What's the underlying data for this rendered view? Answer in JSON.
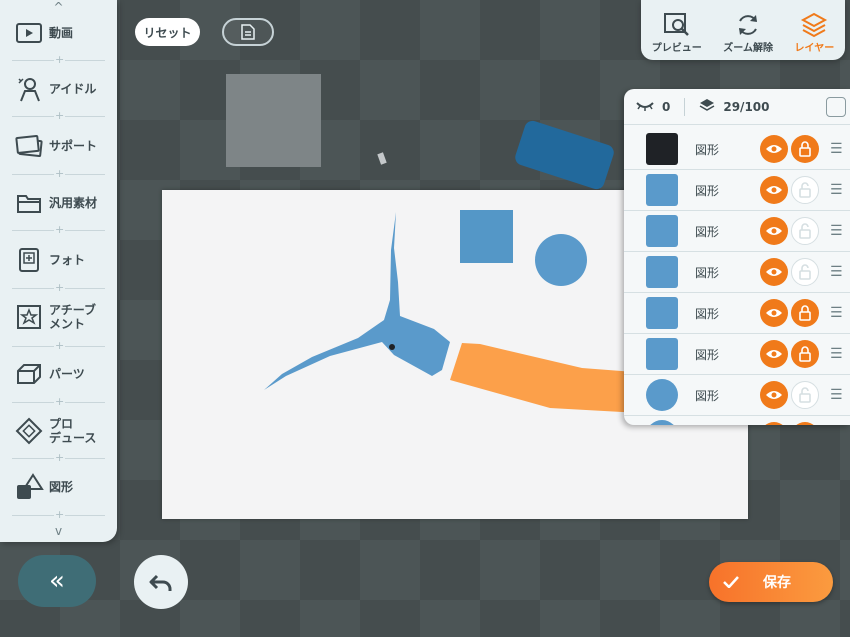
{
  "sidebar": {
    "items": [
      {
        "label": "動画",
        "icon": "video-icon"
      },
      {
        "label": "アイドル",
        "icon": "idol-icon"
      },
      {
        "label": "サポート",
        "icon": "support-icon"
      },
      {
        "label": "汎用素材",
        "icon": "folder-icon"
      },
      {
        "label": "フォト",
        "icon": "photo-icon"
      },
      {
        "label": "アチーブ\nメント",
        "icon": "achievement-icon"
      },
      {
        "label": "パーツ",
        "icon": "parts-icon"
      },
      {
        "label": "プロ\nデュース",
        "icon": "produce-icon"
      },
      {
        "label": "図形",
        "icon": "shape-icon"
      }
    ]
  },
  "top": {
    "reset_label": "リセット"
  },
  "toolbar": {
    "preview_label": "プレビュー",
    "zoom_reset_label": "ズーム解除",
    "layer_label": "レイヤー"
  },
  "layer_panel": {
    "hidden_count": "0",
    "layer_count": "29/100",
    "rows": [
      {
        "name": "図形",
        "color": "#1f2226",
        "shape": "square",
        "locked": true
      },
      {
        "name": "図形",
        "color": "#5a9acb",
        "shape": "square",
        "locked": false
      },
      {
        "name": "図形",
        "color": "#5a9acb",
        "shape": "square",
        "locked": false
      },
      {
        "name": "図形",
        "color": "#5a9acb",
        "shape": "square",
        "locked": false
      },
      {
        "name": "図形",
        "color": "#5a9acb",
        "shape": "square",
        "locked": true
      },
      {
        "name": "図形",
        "color": "#5a9acb",
        "shape": "square",
        "locked": true
      },
      {
        "name": "図形",
        "color": "#5a9acb",
        "shape": "circle",
        "locked": false
      }
    ]
  },
  "bottom": {
    "collapse_label": "«",
    "save_label": "保存"
  },
  "colors": {
    "accent": "#f07a1a",
    "shape_blue": "#5a9acb",
    "shape_dark_blue": "#22699c",
    "shape_orange": "#fca04a"
  }
}
